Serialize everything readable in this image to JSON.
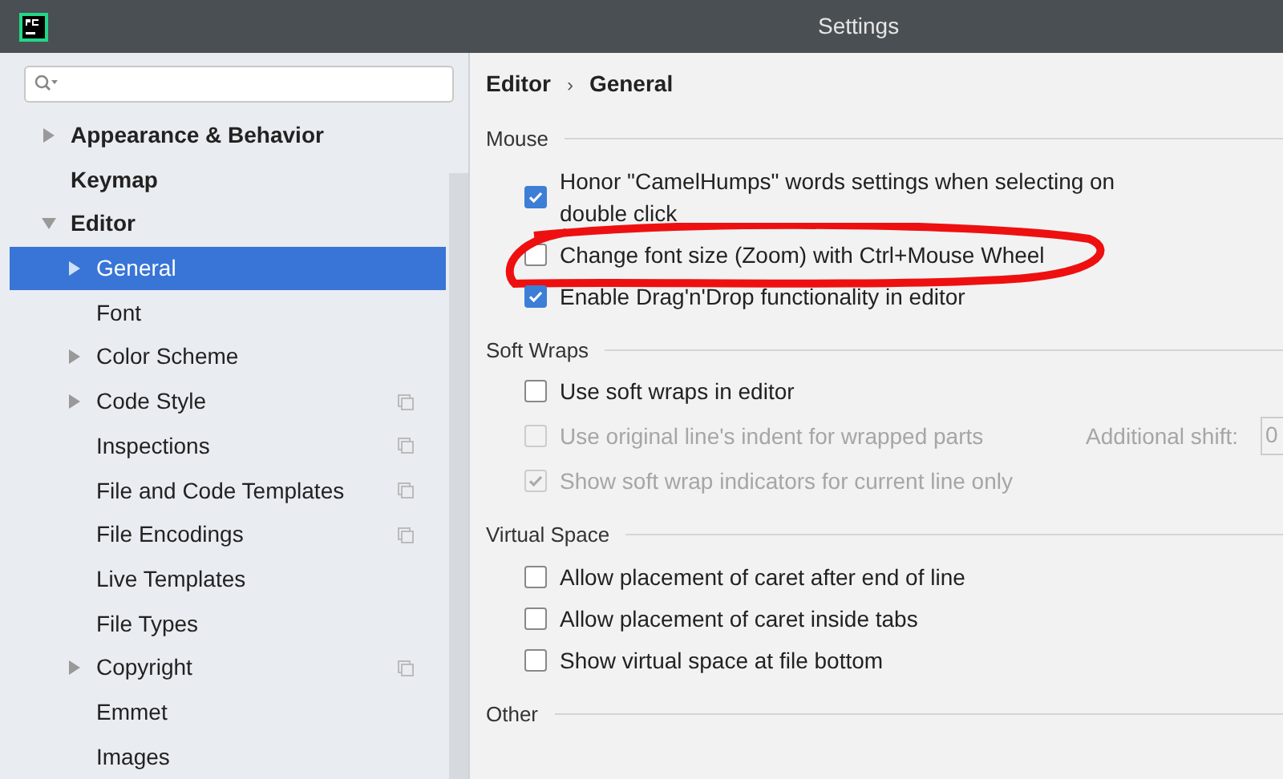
{
  "window": {
    "title": "Settings"
  },
  "sidebar": {
    "items": [
      {
        "label": "Appearance & Behavior",
        "bold": true,
        "expandable": true,
        "expanded": false,
        "selected": false,
        "project_scoped": false
      },
      {
        "label": "Keymap",
        "bold": true,
        "expandable": false,
        "expanded": false,
        "selected": false,
        "project_scoped": false
      },
      {
        "label": "Editor",
        "bold": true,
        "expandable": true,
        "expanded": true,
        "selected": false,
        "project_scoped": false,
        "children": [
          {
            "label": "General",
            "expandable": true,
            "expanded": false,
            "selected": true,
            "project_scoped": false
          },
          {
            "label": "Font",
            "expandable": false,
            "expanded": false,
            "selected": false,
            "project_scoped": false
          },
          {
            "label": "Color Scheme",
            "expandable": true,
            "expanded": false,
            "selected": false,
            "project_scoped": false
          },
          {
            "label": "Code Style",
            "expandable": true,
            "expanded": false,
            "selected": false,
            "project_scoped": true
          },
          {
            "label": "Inspections",
            "expandable": false,
            "expanded": false,
            "selected": false,
            "project_scoped": true
          },
          {
            "label": "File and Code Templates",
            "expandable": false,
            "expanded": false,
            "selected": false,
            "project_scoped": true
          },
          {
            "label": "File Encodings",
            "expandable": false,
            "expanded": false,
            "selected": false,
            "project_scoped": true
          },
          {
            "label": "Live Templates",
            "expandable": false,
            "expanded": false,
            "selected": false,
            "project_scoped": false
          },
          {
            "label": "File Types",
            "expandable": false,
            "expanded": false,
            "selected": false,
            "project_scoped": false
          },
          {
            "label": "Copyright",
            "expandable": true,
            "expanded": false,
            "selected": false,
            "project_scoped": true
          },
          {
            "label": "Emmet",
            "expandable": false,
            "expanded": false,
            "selected": false,
            "project_scoped": false
          },
          {
            "label": "Images",
            "expandable": false,
            "expanded": false,
            "selected": false,
            "project_scoped": false
          }
        ]
      }
    ]
  },
  "breadcrumb": {
    "items": [
      "Editor",
      "General"
    ],
    "separator": "›"
  },
  "sections": [
    {
      "title": "Mouse",
      "options": [
        {
          "label": "Honor \"CamelHumps\" words settings when selecting on double click",
          "checked": true,
          "disabled": false
        },
        {
          "label": "Change font size (Zoom) with Ctrl+Mouse Wheel",
          "checked": false,
          "disabled": false,
          "annotated": true
        },
        {
          "label": "Enable Drag'n'Drop functionality in editor",
          "checked": true,
          "disabled": false
        }
      ]
    },
    {
      "title": "Soft Wraps",
      "options": [
        {
          "label": "Use soft wraps in editor",
          "checked": false,
          "disabled": false
        },
        {
          "label": "Use original line's indent for wrapped parts",
          "checked": false,
          "disabled": true,
          "extra": {
            "label": "Additional shift:",
            "value": "0"
          }
        },
        {
          "label": "Show soft wrap indicators for current line only",
          "checked": true,
          "disabled": true
        }
      ]
    },
    {
      "title": "Virtual Space",
      "options": [
        {
          "label": "Allow placement of caret after end of line",
          "checked": false,
          "disabled": false
        },
        {
          "label": "Allow placement of caret inside tabs",
          "checked": false,
          "disabled": false
        },
        {
          "label": "Show virtual space at file bottom",
          "checked": false,
          "disabled": false
        }
      ]
    },
    {
      "title": "Other"
    }
  ]
}
